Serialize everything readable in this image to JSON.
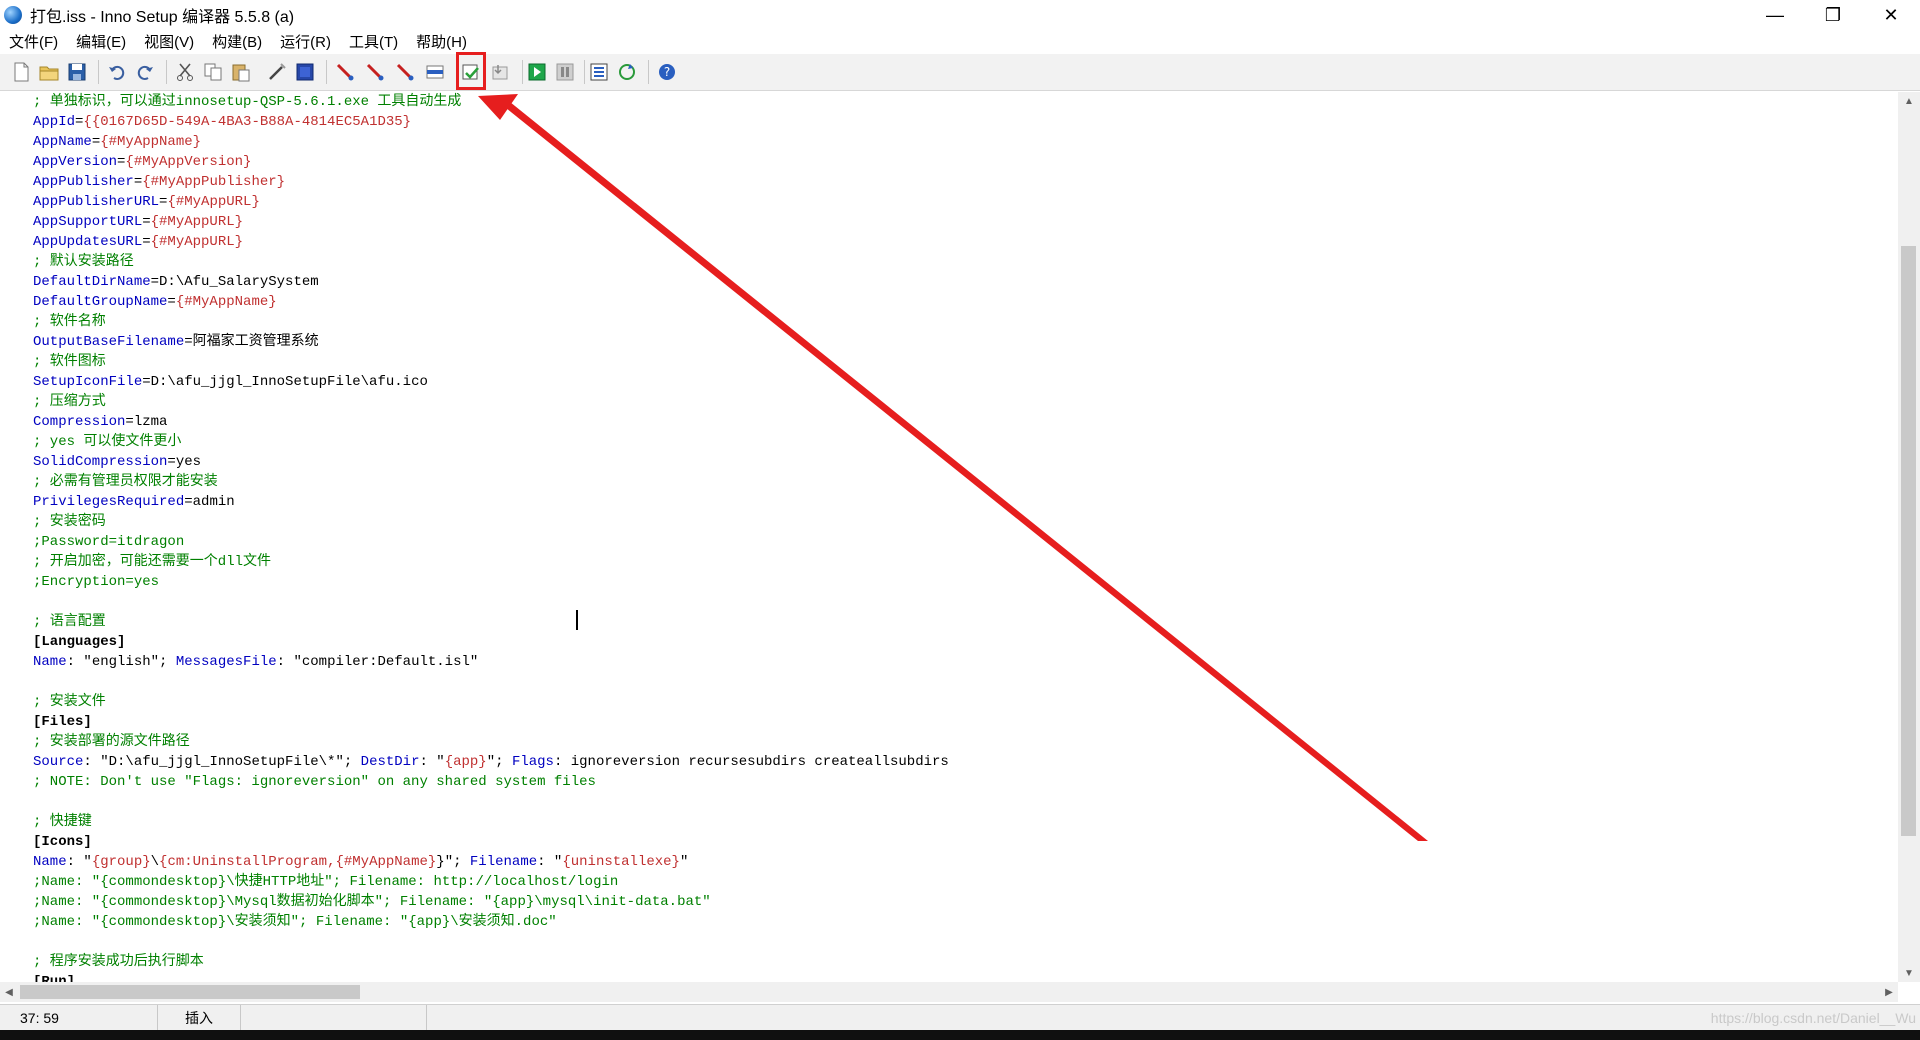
{
  "window": {
    "title": "打包.iss - Inno Setup 编译器 5.5.8 (a)",
    "minimize": "—",
    "maximize": "❐",
    "close": "✕"
  },
  "menu": [
    "文件(F)",
    "编辑(E)",
    "视图(V)",
    "构建(B)",
    "运行(R)",
    "工具(T)",
    "帮助(H)"
  ],
  "toolbar": {
    "buttons": [
      "new-file",
      "open-file",
      "save-file",
      "undo",
      "redo",
      "cut",
      "copy",
      "paste",
      "wizard",
      "compile-stop",
      "compile-1",
      "compile-2",
      "compile-3",
      "compile-4",
      "compile-script",
      "compile-setup",
      "run",
      "pause",
      "options",
      "refresh",
      "help"
    ]
  },
  "code": [
    "; 单独标识，可以通过innosetup-QSP-5.6.1.exe 工具自动生成",
    "AppId={{0167D65D-549A-4BA3-B88A-4814EC5A1D35}",
    "AppName={#MyAppName}",
    "AppVersion={#MyAppVersion}",
    "AppPublisher={#MyAppPublisher}",
    "AppPublisherURL={#MyAppURL}",
    "AppSupportURL={#MyAppURL}",
    "AppUpdatesURL={#MyAppURL}",
    "; 默认安装路径",
    "DefaultDirName=D:\\Afu_SalarySystem",
    "DefaultGroupName={#MyAppName}",
    "; 软件名称",
    "OutputBaseFilename=阿福家工资管理系统",
    "; 软件图标",
    "SetupIconFile=D:\\afu_jjgl_InnoSetupFile\\afu.ico",
    "; 压缩方式",
    "Compression=lzma",
    "; yes 可以使文件更小",
    "SolidCompression=yes",
    "; 必需有管理员权限才能安装",
    "PrivilegesRequired=admin",
    "; 安装密码",
    ";Password=itdragon",
    "; 开启加密，可能还需要一个dll文件",
    ";Encryption=yes",
    "",
    "; 语言配置",
    "[Languages]",
    "Name: \"english\"; MessagesFile: \"compiler:Default.isl\"",
    "",
    "; 安装文件",
    "[Files]",
    "; 安装部署的源文件路径",
    "Source: \"D:\\afu_jjgl_InnoSetupFile\\*\"; DestDir: \"{app}\"; Flags: ignoreversion recursesubdirs createallsubdirs",
    "; NOTE: Don't use \"Flags: ignoreversion\" on any shared system files",
    "",
    "; 快捷键",
    "[Icons]",
    "Name: \"{group}\\{cm:UninstallProgram,{#MyAppName}}\"; Filename: \"{uninstallexe}\"",
    ";Name: \"{commondesktop}\\快捷HTTP地址\"; Filename: http://localhost/login",
    ";Name: \"{commondesktop}\\Mysql数据初始化脚本\"; Filename: \"{app}\\mysql\\init-data.bat\"",
    ";Name: \"{commondesktop}\\安装须知\"; Filename: \"{app}\\安装须知.doc\"",
    "",
    "; 程序安装成功后执行脚本",
    "[Run]"
  ],
  "status": {
    "position": "37: 59",
    "mode": "插入",
    "watermark": "https://blog.csdn.net/Daniel__Wu"
  },
  "colors": {
    "comment": "#008000",
    "key": "#0000c0",
    "constant": "#c03030",
    "annotation": "#e61e1e"
  }
}
